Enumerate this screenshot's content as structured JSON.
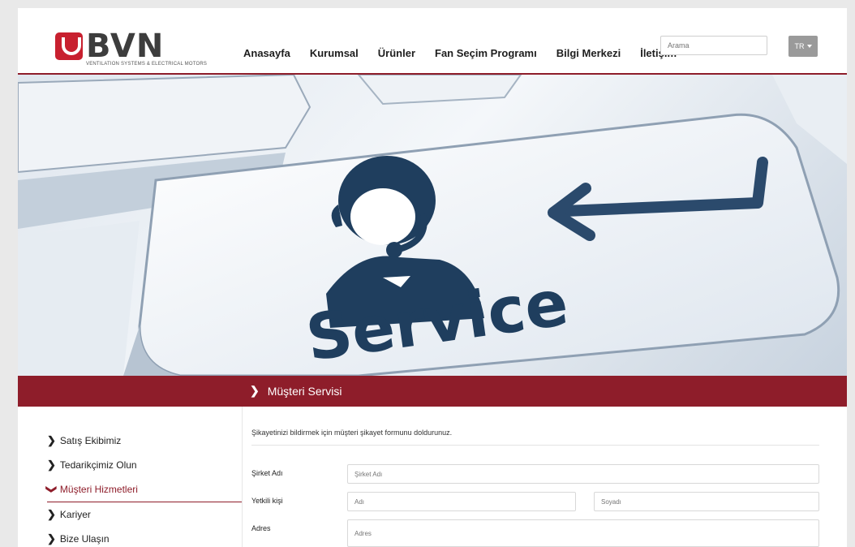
{
  "brand": {
    "name": "BVN",
    "tagline": "VENTILATION SYSTEMS & ELECTRICAL MOTORS",
    "color": "#c8202f"
  },
  "nav": [
    "Anasayfa",
    "Kurumsal",
    "Ürünler",
    "Fan Seçim Programı",
    "Bilgi Merkezi",
    "İletişim"
  ],
  "search": {
    "placeholder": "Arama"
  },
  "language": {
    "selected": "TR"
  },
  "hero": {
    "text": "Service"
  },
  "page_title": "Müşteri Servisi",
  "sidebar": {
    "items": [
      {
        "label": "Satış Ekibimiz",
        "active": false
      },
      {
        "label": "Tedarikçimiz Olun",
        "active": false
      },
      {
        "label": "Müşteri Hizmetleri",
        "active": true
      },
      {
        "label": "Kariyer",
        "active": false
      },
      {
        "label": "Bize Ulaşın",
        "active": false
      }
    ]
  },
  "form": {
    "intro": "Şikayetinizi bildirmek için müşteri şikayet formunu doldurunuz.",
    "company": {
      "label": "Şirket Adı",
      "placeholder": "Şirket Adı"
    },
    "contact": {
      "label": "Yetkili kişi",
      "first_placeholder": "Adı",
      "last_placeholder": "Soyadı"
    },
    "address": {
      "label": "Adres",
      "placeholder": "Adres"
    }
  },
  "colors": {
    "accent": "#8e1d2a",
    "icon": "#1f3e5e"
  }
}
